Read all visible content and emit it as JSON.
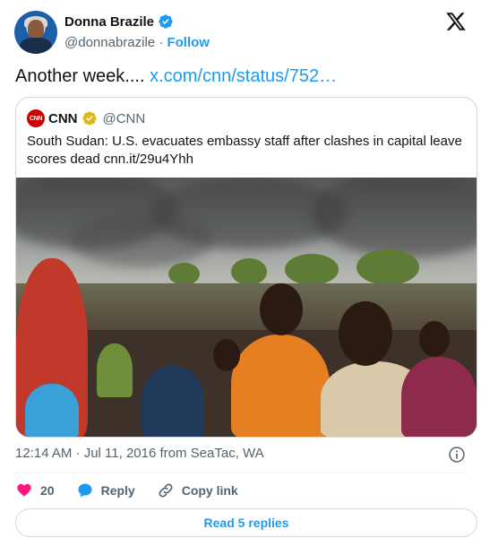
{
  "author": {
    "display_name": "Donna Brazile",
    "handle": "@donnabrazile",
    "separator": "·",
    "follow_label": "Follow"
  },
  "tweet": {
    "text": "Another week....",
    "link": "x.com/cnn/status/752…"
  },
  "quoted": {
    "logo_text": "CNN",
    "name": "CNN",
    "handle": "@CNN",
    "text": "South Sudan: U.S. evacuates embassy staff after clashes in capital leave scores dead cnn.it/29u4Yhh"
  },
  "meta": {
    "timestamp": "12:14 AM · Jul 11, 2016 from SeaTac, WA"
  },
  "actions": {
    "like_count": "20",
    "reply_label": "Reply",
    "copy_link_label": "Copy link"
  },
  "replies_button": "Read 5 replies",
  "colors": {
    "accent": "#1d9bf0",
    "like": "#f91880",
    "text_secondary": "#536471",
    "border": "#cfd9de",
    "gold_badge": "#e2b719"
  }
}
